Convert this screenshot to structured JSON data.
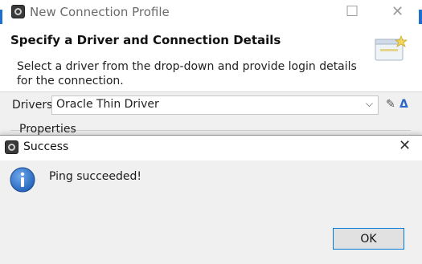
{
  "background_dialog": {
    "title": "New Connection Profile",
    "heading": "Specify a Driver and Connection Details",
    "description": "Select a driver from the drop-down and provide login details for the connection.",
    "drivers_label": "Drivers:",
    "drivers_selected": "Oracle Thin Driver",
    "properties_label": "Properties",
    "icons": [
      "app-icon",
      "minimize-icon",
      "close-icon",
      "wizard-icon",
      "chevron-down-icon",
      "edit-driver-icon",
      "new-driver-icon"
    ]
  },
  "success_dialog": {
    "title": "Success",
    "message": "Ping succeeded!",
    "ok_label": "OK",
    "icons": [
      "app-icon",
      "info-icon",
      "close-icon"
    ]
  },
  "colors": {
    "accent": "#0078d7",
    "info_blue": "#1f5fb8"
  }
}
